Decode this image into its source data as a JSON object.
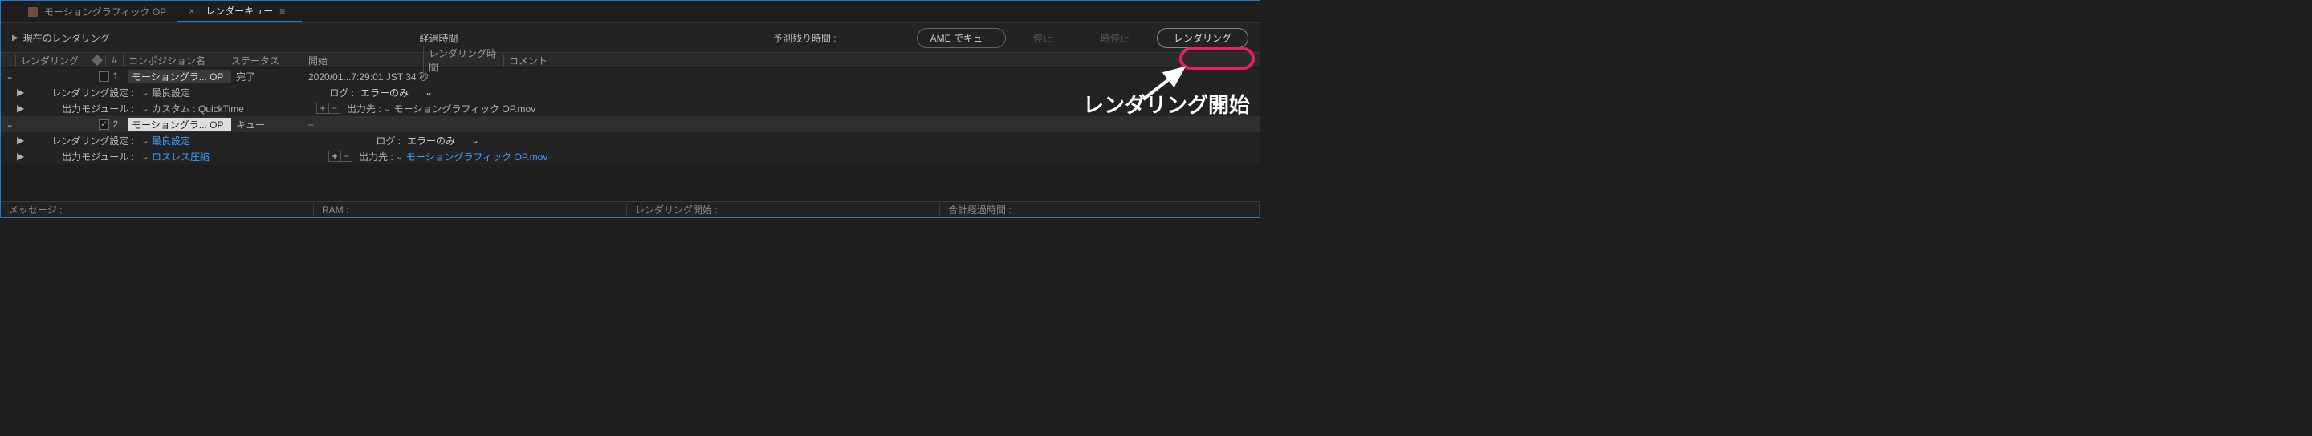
{
  "tabs": {
    "composition": "モーショングラフィック  OP",
    "render_queue": "レンダーキュー",
    "close_glyph": "×",
    "menu_glyph": "≡"
  },
  "toolbar": {
    "current_rendering": "現在のレンダリング",
    "elapsed_time_label": "経過時間 :",
    "est_remain_label": "予測残り時間 :",
    "ame_queue": "AME でキュー",
    "stop": "停止",
    "pause": "一時停止",
    "render": "レンダリング"
  },
  "headers": {
    "render": "レンダリング",
    "num": "#",
    "comp_name": "コンポジション名",
    "status": "ステータス",
    "start": "開始",
    "render_time": "レンダリング時間",
    "comment": "コメント"
  },
  "items": [
    {
      "checked": false,
      "number": "1",
      "comp_name": "モーショングラ... OP",
      "status": "完了",
      "start": "2020/01...7:29:01 JST 34 秒",
      "render_settings_label": "レンダリング設定 :",
      "render_settings_value": "最良設定",
      "output_module_label": "出力モジュール :",
      "output_module_value": "カスタム : QuickTime",
      "log_label": "ログ :",
      "log_value": "エラーのみ",
      "output_to_label": "出力先 :",
      "output_to_value": "モーショングラフィック OP.mov"
    },
    {
      "checked": true,
      "number": "2",
      "comp_name": "モーショングラ... OP",
      "status": "キュー",
      "start": "–",
      "render_settings_label": "レンダリング設定 :",
      "render_settings_value": "最良設定",
      "output_module_label": "出力モジュール :",
      "output_module_value": "ロスレス圧縮",
      "log_label": "ログ :",
      "log_value": "エラーのみ",
      "output_to_label": "出力先 :",
      "output_to_value": "モーショングラフィック OP.mov"
    }
  ],
  "footer": {
    "message": "メッセージ :",
    "ram": "RAM :",
    "render_start": "レンダリング開始 :",
    "total_elapsed": "合計経過時間 :"
  },
  "annotation": {
    "text": "レンダリング開始"
  },
  "glyphs": {
    "twirl_right": "▶",
    "twirl_down": "▽",
    "chevron_down": "⌄",
    "check": "✓"
  }
}
